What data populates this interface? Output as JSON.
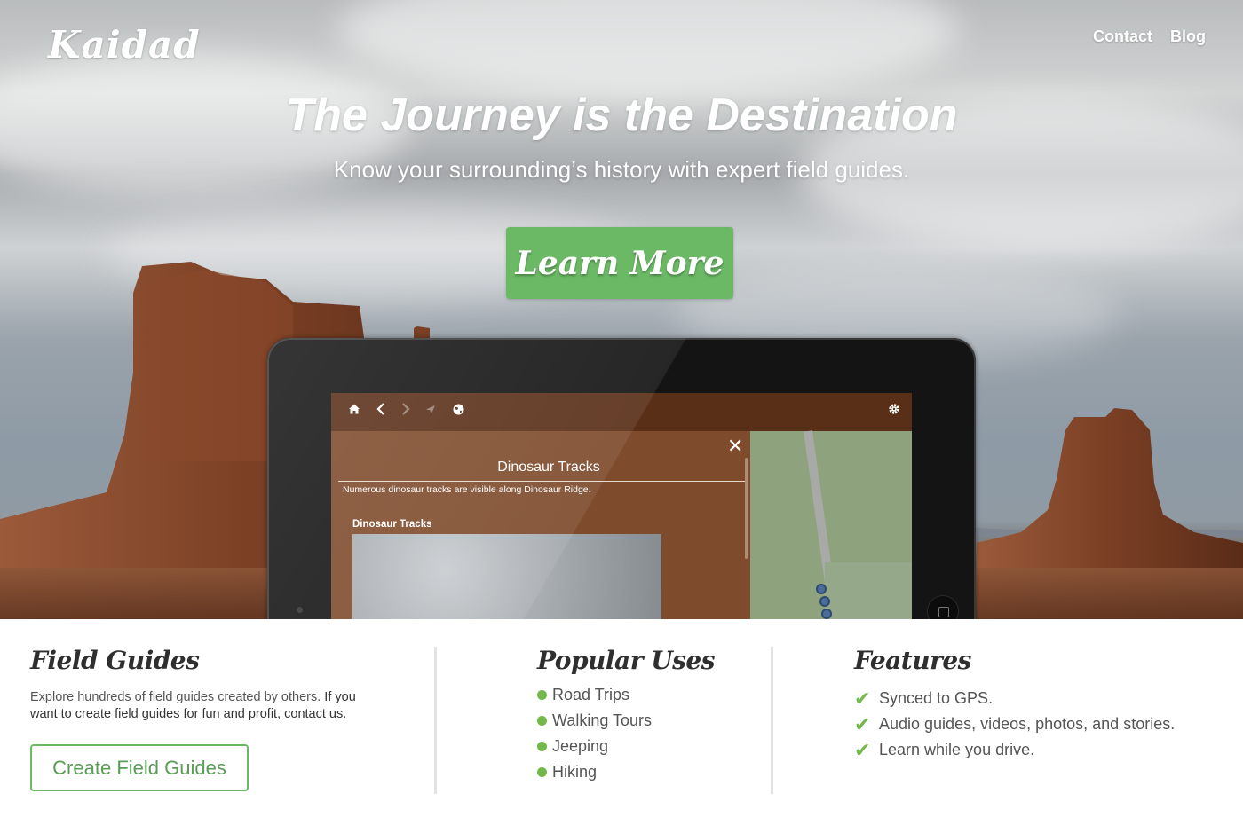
{
  "brand": {
    "logo": "Kaidad"
  },
  "nav": {
    "contact": "Contact",
    "blog": "Blog"
  },
  "hero": {
    "headline": "The Journey is the Destination",
    "subhead": "Know your surrounding’s history with expert field guides.",
    "cta_label": "Learn More"
  },
  "app_preview": {
    "toolbar_icons": [
      "home-icon",
      "back-icon",
      "forward-icon",
      "location-icon",
      "globe-icon",
      "gear-icon"
    ],
    "close_label": "✕",
    "panel_title": "Dinosaur Tracks",
    "panel_description": "Numerous dinosaur tracks are visible along Dinosaur Ridge.",
    "image_caption": "Dinosaur Tracks"
  },
  "field_guides": {
    "heading": "Field Guides",
    "text_lead": "Explore hundreds of field guides created by others. ",
    "text_emphasis": "If you want to create field guides for fun and profit, contact us.",
    "button_label": "Create Field Guides"
  },
  "popular_uses": {
    "heading": "Popular Uses",
    "items": [
      "Road Trips",
      "Walking Tours",
      "Jeeping",
      "Hiking"
    ]
  },
  "features": {
    "heading": "Features",
    "items": [
      "Synced to GPS.",
      "Audio guides, videos, photos, and stories.",
      "Learn while you drive."
    ]
  },
  "colors": {
    "accent_green": "#6bb965",
    "bullet_green": "#72b84a",
    "app_brown": "#5a2f18"
  }
}
